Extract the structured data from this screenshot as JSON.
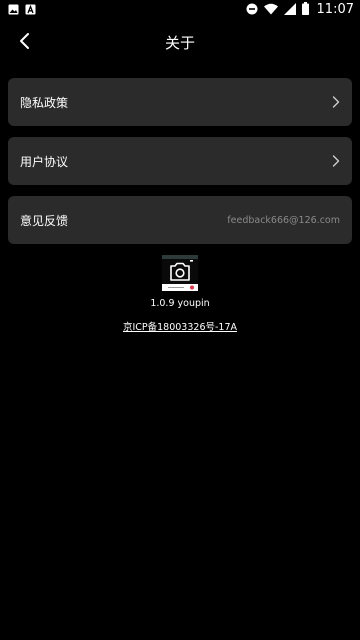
{
  "status_bar": {
    "time": "11:07",
    "icons": [
      "image-icon",
      "text-a-icon",
      "do-not-disturb-icon",
      "wifi-icon",
      "signal-icon",
      "battery-icon"
    ]
  },
  "header": {
    "title": "关于",
    "back_icon": "chevron-left-icon"
  },
  "menu": {
    "items": [
      {
        "label": "隐私政策",
        "value": "",
        "icon": "chevron-right-icon"
      },
      {
        "label": "用户协议",
        "value": "",
        "icon": "chevron-right-icon"
      },
      {
        "label": "意见反馈",
        "value": "feedback666@126.com"
      }
    ]
  },
  "app_info": {
    "logo_icon": "camera-icon",
    "version": "1.0.9 youpin",
    "icp": "京ICP备18003326号-17A"
  },
  "colors": {
    "background": "#000000",
    "card": "#2b2b2b",
    "secondary_text": "#8a8a8a",
    "logo_accent": "#e03a4a"
  }
}
